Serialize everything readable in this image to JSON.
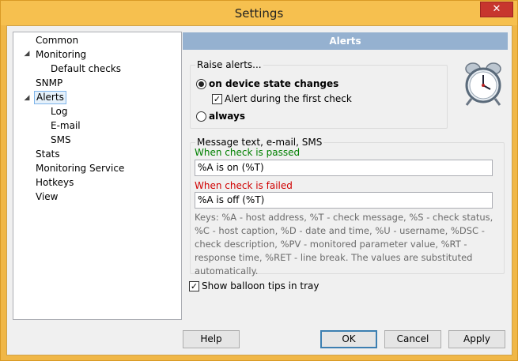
{
  "window": {
    "title": "Settings",
    "close_glyph": "✕"
  },
  "tree": {
    "items": [
      {
        "label": "Common"
      },
      {
        "label": "Monitoring"
      },
      {
        "label": "Default checks"
      },
      {
        "label": "SNMP"
      },
      {
        "label": "Alerts"
      },
      {
        "label": "Log"
      },
      {
        "label": "E-mail"
      },
      {
        "label": "SMS"
      },
      {
        "label": "Stats"
      },
      {
        "label": "Monitoring Service"
      },
      {
        "label": "Hotkeys"
      },
      {
        "label": "View"
      }
    ],
    "selected": "Alerts",
    "expander_glyph": "◢"
  },
  "panel": {
    "header": "Alerts",
    "raise_group": {
      "legend": "Raise alerts...",
      "on_state_change": "on device state changes",
      "first_check": "Alert during the first check",
      "always": "always"
    },
    "message_group": {
      "legend": "Message text, e-mail, SMS",
      "passed_label": "When check is passed",
      "passed_value": "%A is on (%T)",
      "failed_label": "When check is failed",
      "failed_value": "%A is off (%T)",
      "keys": "Keys: %A - host address, %T - check message, %S - check status, %C - host caption, %D - date and time, %U - username, %DSC - check description, %PV - monitored parameter value, %RT - response time, %RET - line break. The values are substituted automatically."
    },
    "balloon_tips": "Show balloon tips in tray",
    "check_glyph": "✓"
  },
  "buttons": {
    "help": "Help",
    "ok": "OK",
    "cancel": "Cancel",
    "apply": "Apply"
  },
  "colors": {
    "header": "#95b1d0",
    "passed": "#008000",
    "failed": "#d00000",
    "titlebar": "#f6c04f"
  }
}
